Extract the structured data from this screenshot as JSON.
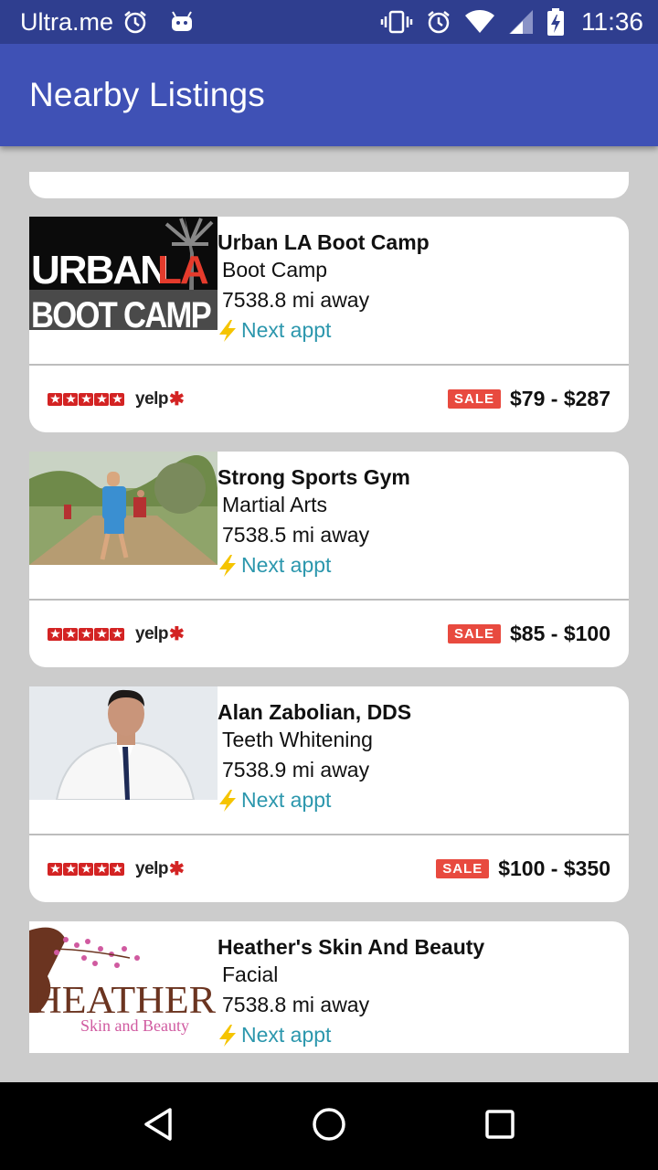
{
  "status_bar": {
    "carrier": "Ultra.me",
    "time": "11:36"
  },
  "app_bar": {
    "title": "Nearby Listings"
  },
  "listings": [
    {
      "name": "Urban LA Boot Camp",
      "category": "Boot Camp",
      "distance": "7538.8 mi away",
      "next_appt": "Next appt",
      "rating_source": "yelp",
      "rating": 5,
      "sale_label": "SALE",
      "price": "$79 - $287",
      "thumb_text_1": "URBAN",
      "thumb_text_accent": "LA",
      "thumb_text_2": "BOOT CAMP"
    },
    {
      "name": "Strong Sports Gym",
      "category": "Martial Arts",
      "distance": "7538.5 mi away",
      "next_appt": "Next appt",
      "rating_source": "yelp",
      "rating": 5,
      "sale_label": "SALE",
      "price": "$85 - $100"
    },
    {
      "name": "Alan Zabolian, DDS",
      "category": "Teeth Whitening",
      "distance": "7538.9 mi away",
      "next_appt": "Next appt",
      "rating_source": "yelp",
      "rating": 5,
      "sale_label": "SALE",
      "price": "$100 - $350"
    },
    {
      "name": "Heather's Skin And Beauty",
      "category": "Facial",
      "distance": "7538.8 mi away",
      "next_appt": "Next appt",
      "thumb_text_1": "HEATHER",
      "thumb_text_2": "Skin and Beauty"
    }
  ],
  "colors": {
    "status_bar": "#2f3e8f",
    "app_bar": "#3f51b5",
    "accent_link": "#2c97ad",
    "sale_badge": "#e84a3f",
    "yelp_red": "#d32323",
    "background": "#cccccc"
  },
  "icons": {
    "status_left": [
      "alarm-icon",
      "android-debug-icon"
    ],
    "status_right": [
      "vibrate-icon",
      "alarm-icon",
      "wifi-icon",
      "signal-icon",
      "battery-charging-icon"
    ],
    "nav": [
      "back-icon",
      "home-icon",
      "recents-icon"
    ],
    "next_appt": "lightning-bolt-icon"
  }
}
